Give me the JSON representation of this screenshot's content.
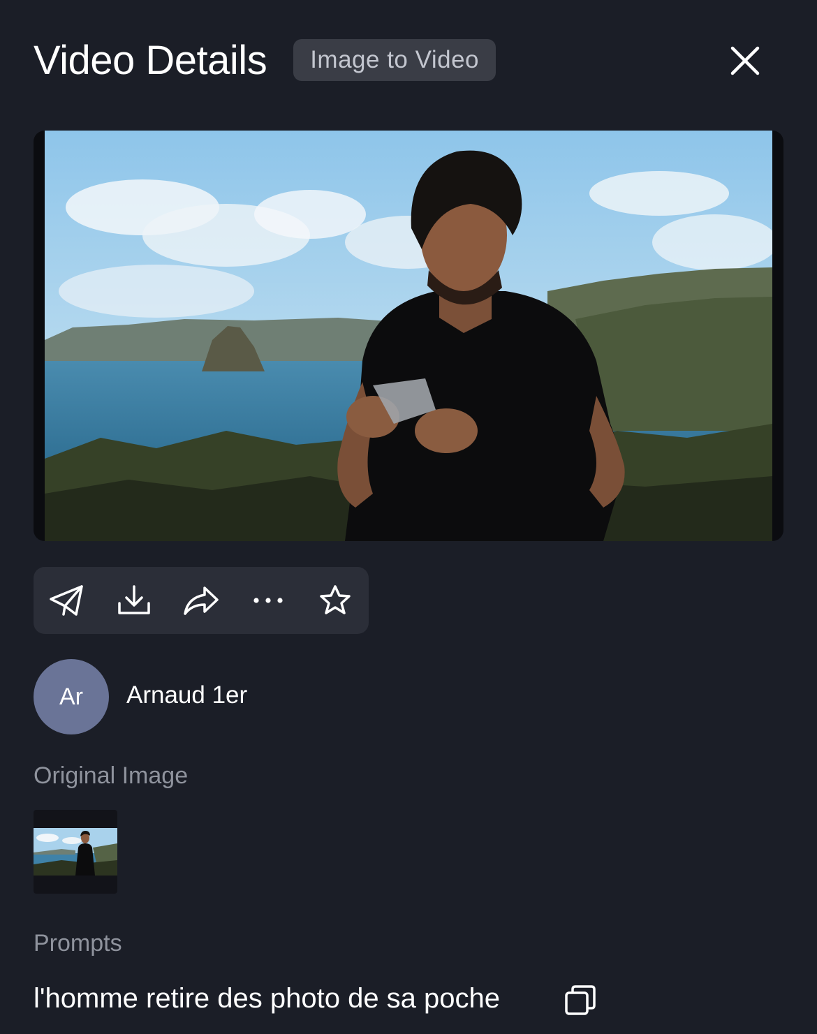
{
  "header": {
    "title": "Video Details",
    "badge": "Image to Video"
  },
  "icons": {
    "close": "close-icon",
    "send": "send-icon",
    "download": "download-icon",
    "share": "share-icon",
    "more": "more-icon",
    "favorite": "star-icon",
    "copy": "copy-icon"
  },
  "author": {
    "initials": "Ar",
    "name": "Arnaud 1er"
  },
  "sections": {
    "original_image": "Original Image",
    "prompts": "Prompts"
  },
  "prompt": {
    "text": "l'homme retire des photo de sa poche"
  },
  "colors": {
    "background": "#1b1e27",
    "panel": "#2b2e38",
    "avatar": "#6a7497",
    "muted_text": "#8f939d"
  }
}
